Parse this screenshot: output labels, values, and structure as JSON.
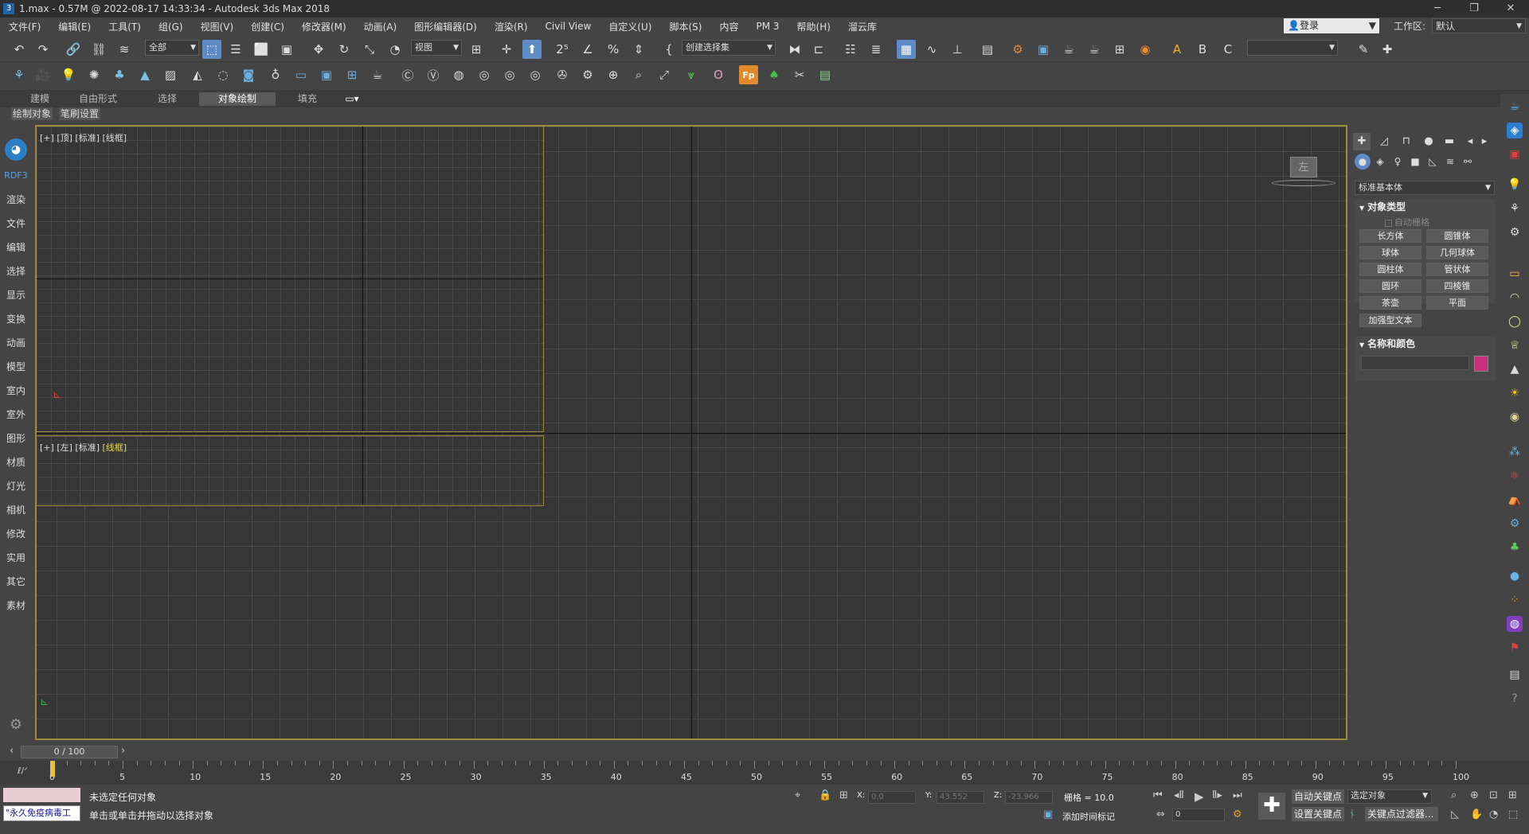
{
  "window": {
    "title": "1.max - 0.57M @ 2022-08-17 14:33:34 - Autodesk 3ds Max 2018",
    "app_icon": "3",
    "buttons": [
      "─",
      "❐",
      "✕"
    ]
  },
  "menu": [
    "文件(F)",
    "编辑(E)",
    "工具(T)",
    "组(G)",
    "视图(V)",
    "创建(C)",
    "修改器(M)",
    "动画(A)",
    "图形编辑器(D)",
    "渲染(R)",
    "Civil View",
    "自定义(U)",
    "脚本(S)",
    "内容",
    "PM 3",
    "帮助(H)",
    "溜云库"
  ],
  "login": {
    "label": "登录"
  },
  "workspace": {
    "label": "工作区:",
    "value": "默认"
  },
  "toolbar1": {
    "selection_filter": "全部",
    "ref_coord": "视图",
    "named_selection": "创建选择集"
  },
  "ribbon": {
    "tabs": [
      "建模",
      "自由形式",
      "选择",
      "对象绘制",
      "填充"
    ],
    "active_tab": "对象绘制",
    "sub_tabs": [
      "绘制对象",
      "笔刷设置"
    ]
  },
  "left_sidebar": {
    "logo_label": "RDF3",
    "items": [
      "渲染",
      "文件",
      "编辑",
      "选择",
      "显示",
      "变换",
      "动画",
      "模型",
      "室内",
      "室外",
      "图形",
      "材质",
      "灯光",
      "相机",
      "修改",
      "实用",
      "其它",
      "素材"
    ]
  },
  "viewports": {
    "top": {
      "plus": "[+]",
      "name": "[顶]",
      "shading": "[标准]",
      "mode": "[线框]"
    },
    "left": {
      "plus": "[+]",
      "name": "[左]",
      "shading": "[标准]",
      "mode": "[线框]"
    },
    "viewcube_label": "左"
  },
  "command_panel": {
    "category": "标准基本体",
    "object_type": {
      "title": "对象类型",
      "autogrid": "自动栅格",
      "buttons": [
        "长方体",
        "圆锥体",
        "球体",
        "几何球体",
        "圆柱体",
        "管状体",
        "圆环",
        "四棱锥",
        "茶壶",
        "平面",
        "加强型文本"
      ]
    },
    "name_color": {
      "title": "名称和颜色",
      "color": "#c8317a"
    }
  },
  "timeline": {
    "frame_display": "0 / 100",
    "ticks": [
      "0",
      "5",
      "10",
      "15",
      "20",
      "25",
      "30",
      "35",
      "40",
      "45",
      "50",
      "55",
      "60",
      "65",
      "70",
      "75",
      "80",
      "85",
      "90",
      "95",
      "100"
    ]
  },
  "status": {
    "maxscript_text": "\"永久免疫病毒工",
    "line1": "未选定任何对象",
    "line2": "单击或单击并拖动以选择对象",
    "x_label": "X:",
    "x": "0.0",
    "y_label": "Y:",
    "y": "43.552",
    "z_label": "Z:",
    "z": "-23.966",
    "grid": "栅格 = 10.0",
    "add_time_tag": "添加时间标记",
    "auto_key": "自动关键点",
    "selected_obj": "选定对象",
    "set_key": "设置关键点",
    "key_filters": "关键点过滤器...",
    "frame_field": "0"
  }
}
